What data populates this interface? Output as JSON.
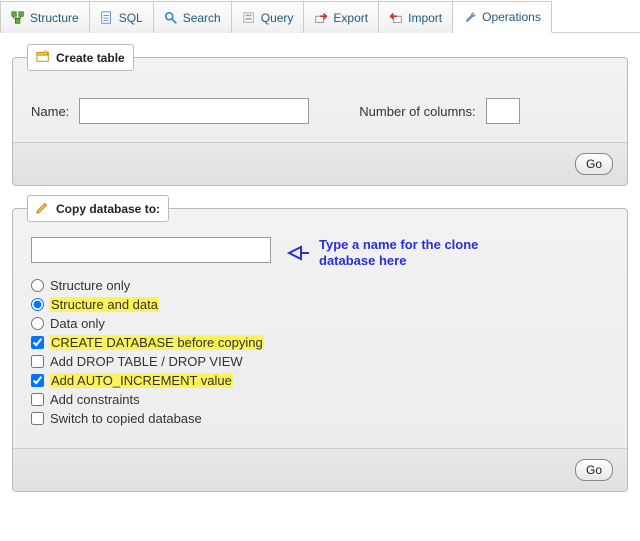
{
  "tabs": {
    "structure": "Structure",
    "sql": "SQL",
    "search": "Search",
    "query": "Query",
    "export": "Export",
    "import": "Import",
    "operations": "Operations"
  },
  "create_table": {
    "legend": "Create table",
    "name_label": "Name:",
    "name_value": "",
    "cols_label": "Number of columns:",
    "cols_value": "",
    "go": "Go"
  },
  "copy_db": {
    "legend": "Copy database to:",
    "input_value": "",
    "annotation": "Type a name for the clone database here",
    "options": {
      "structure_only": "Structure only",
      "structure_and_data": "Structure and data",
      "data_only": "Data only",
      "create_before": "CREATE DATABASE before copying",
      "add_drop": "Add DROP TABLE / DROP VIEW",
      "auto_increment": "Add AUTO_INCREMENT value",
      "add_constraints": "Add constraints",
      "switch": "Switch to copied database"
    },
    "go": "Go"
  }
}
